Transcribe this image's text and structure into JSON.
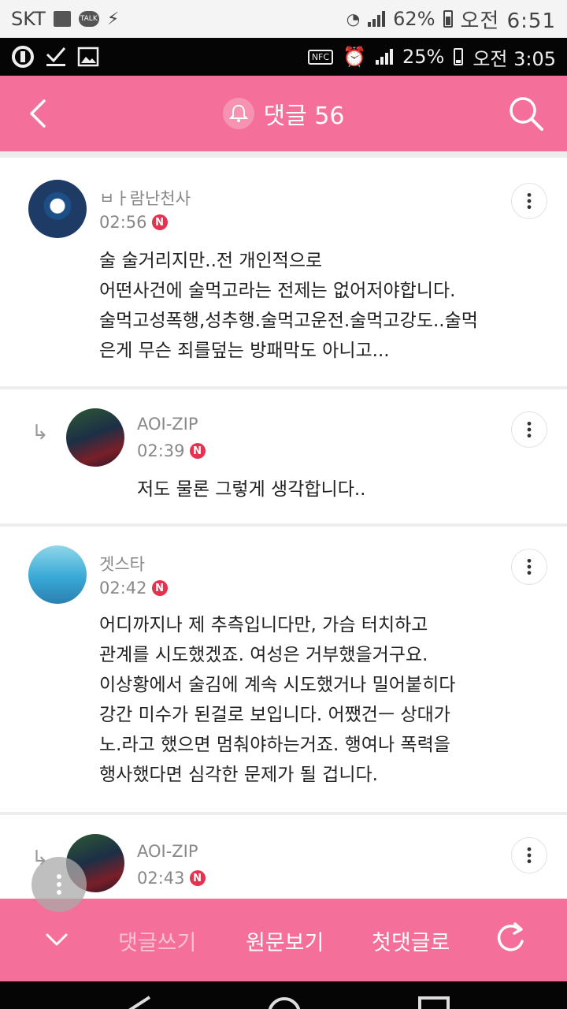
{
  "status_outer": {
    "carrier": "SKT",
    "battery": "62%",
    "time": "오전 6:51",
    "talk_badge": "TALK"
  },
  "status_inner": {
    "nfc": "NFC",
    "battery": "25%",
    "time": "오전 3:05"
  },
  "header": {
    "title": "댓글 56"
  },
  "comments": [
    {
      "author": "ㅂㅏ람난천사",
      "time": "02:56",
      "badge": "N",
      "text": "술 술거리지만..전 개인적으로\n어떤사건에 술먹고라는 전제는 없어저야합니다.\n술먹고성폭행,성추행.술먹고운전.술먹고강도..술먹\n은게 무슨 죄를덮는 방패막도 아니고..."
    },
    {
      "author": "AOI-ZIP",
      "time": "02:39",
      "badge": "N",
      "text": "저도 물론 그렇게 생각합니다.."
    },
    {
      "author": "겟스타",
      "time": "02:42",
      "badge": "N",
      "text": "어디까지나 제 추측입니다만, 가슴 터치하고\n관계를 시도했겠죠. 여성은 거부했을거구요.\n이상황에서 술김에 계속 시도했거나 밀어붙히다\n강간 미수가 된걸로 보입니다. 어쨌건ㅡ 상대가\n노.라고 했으면 멈춰야하는거죠. 행여나 폭력을\n행사했다면 심각한 문제가 될 겁니다."
    },
    {
      "author": "AOI-ZIP",
      "time": "02:43",
      "badge": "N"
    }
  ],
  "bottom_bar": {
    "write": "댓글쓰기",
    "original": "원문보기",
    "first": "첫댓글로"
  },
  "colors": {
    "accent": "#f46f99",
    "badge": "#e8304f"
  },
  "icons": {
    "back": "chevron-left-icon",
    "search": "search-icon",
    "bell": "bell-icon",
    "more": "more-vertical-icon",
    "reply": "reply-arrow-icon",
    "collapse": "chevron-down-icon",
    "refresh": "refresh-icon"
  }
}
